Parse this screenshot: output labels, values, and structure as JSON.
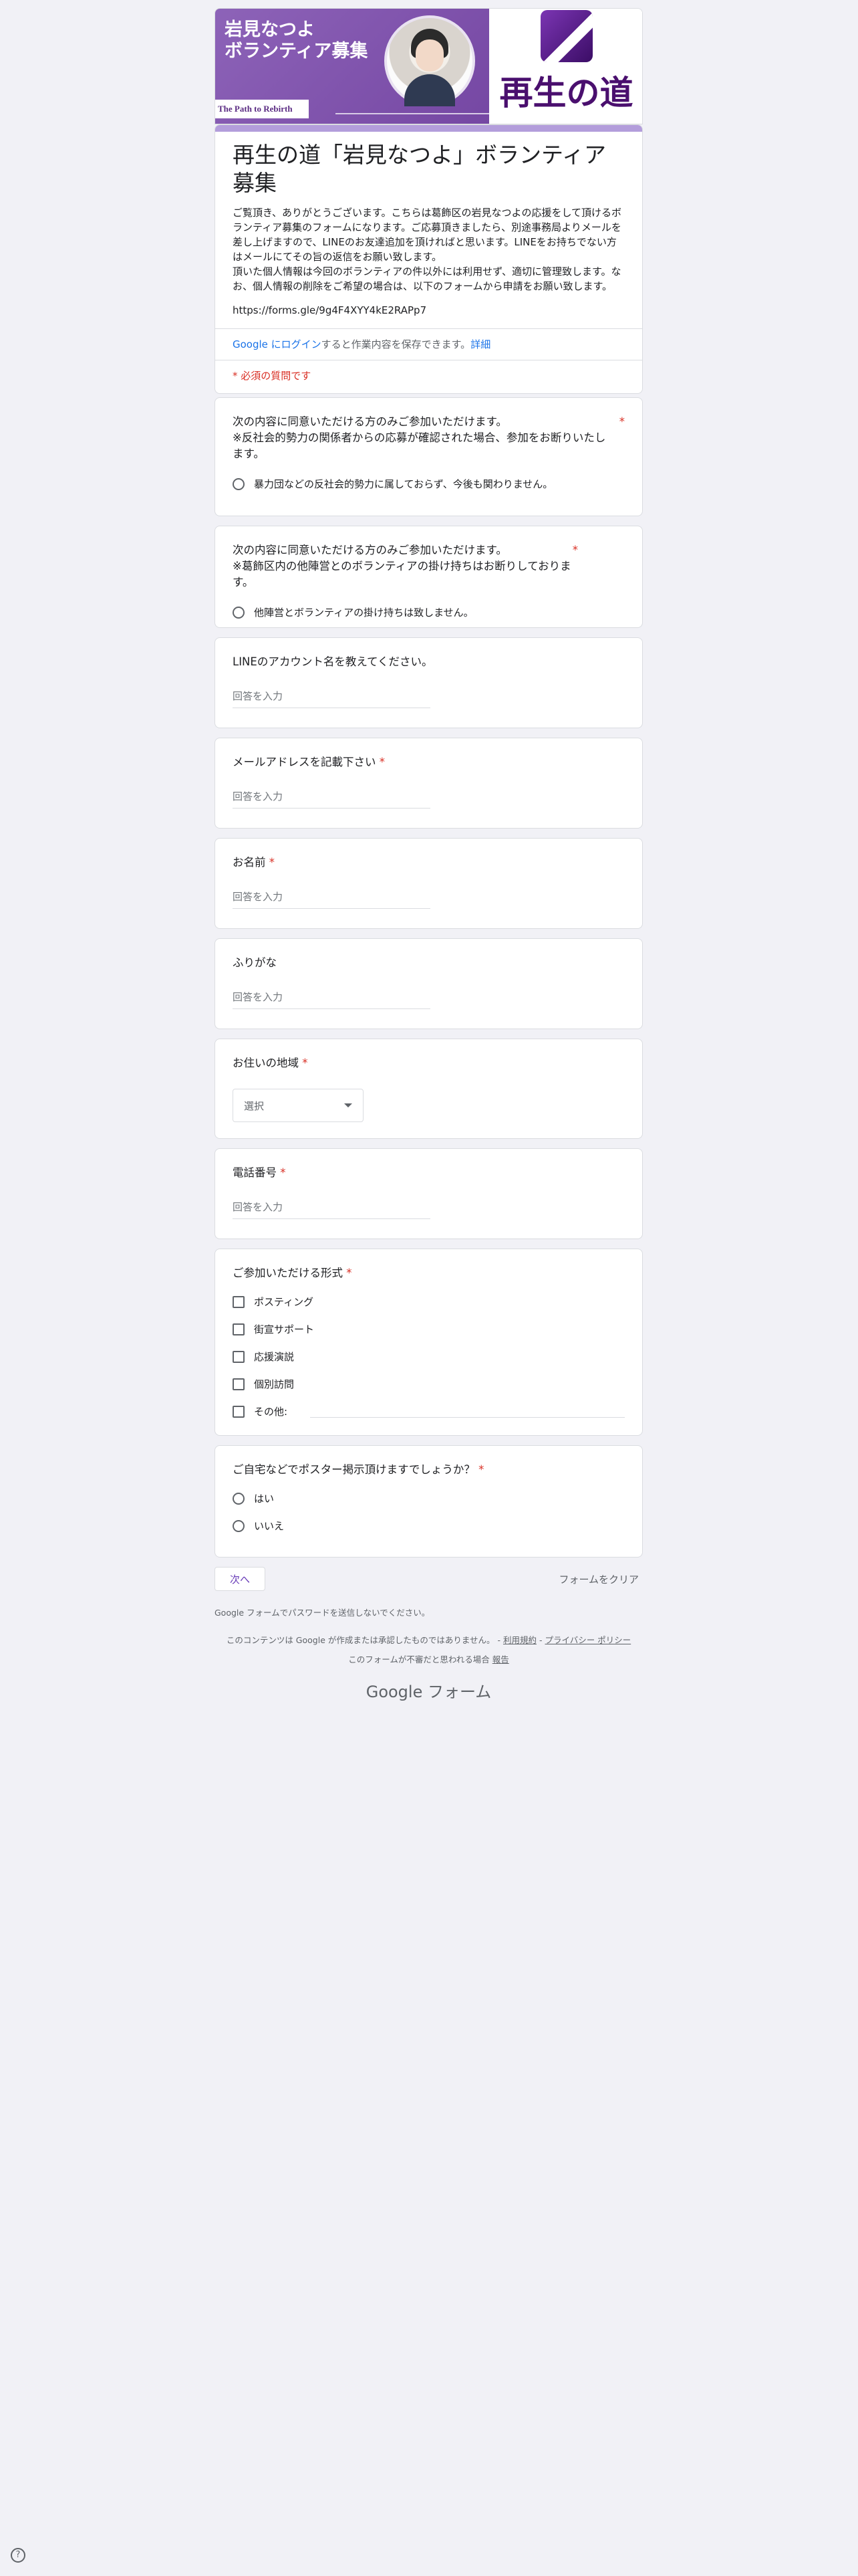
{
  "banner": {
    "title_line1": "岩見なつよ",
    "title_line2": "ボランティア募集",
    "tagline": "The Path to Rebirth",
    "logo_text": "再生の道"
  },
  "form": {
    "title": "再生の道「岩見なつよ」ボランティア募集",
    "description": "ご覧頂き、ありがとうございます。こちらは葛飾区の岩見なつよの応援をして頂けるボランティア募集のフォームになります。ご応募頂きましたら、別途事務局よりメールを差し上げますので、LINEのお友達追加を頂ければと思います。LINEをお持ちでない方はメールにてその旨の返信をお願い致します。\n頂いた個人情報は今回のボランティアの件以外には利用せず、適切に管理致します。なお、個人情報の削除をご希望の場合は、以下のフォームから申請をお願い致します。",
    "url": "https://forms.gle/9g4F4XYY4kE2RAPp7",
    "login_link": "Google にログイン",
    "login_rest": "すると作業内容を保存できます。",
    "login_more": "詳細",
    "required_note": "* 必須の質問です"
  },
  "questions": {
    "q1": {
      "title": "次の内容に同意いただける方のみご参加いただけます。\n※反社会的勢力の関係者からの応募が確認された場合、参加をお断りいたします。",
      "required": "*",
      "option": "暴力団などの反社会的勢力に属しておらず、今後も関わりません。"
    },
    "q2": {
      "title": "次の内容に同意いただける方のみご参加いただけます。\n※葛飾区内の他陣営とのボランティアの掛け持ちはお断りしております。",
      "required": "*",
      "option": "他陣営とボランティアの掛け持ちは致しません。"
    },
    "q3": {
      "title": "LINEのアカウント名を教えてください。",
      "placeholder": "回答を入力"
    },
    "q4": {
      "title": "メールアドレスを記載下さい",
      "required": "*",
      "placeholder": "回答を入力"
    },
    "q5": {
      "title": "お名前",
      "required": "*",
      "placeholder": "回答を入力"
    },
    "q6": {
      "title": "ふりがな",
      "placeholder": "回答を入力"
    },
    "q7": {
      "title": "お住いの地域",
      "required": "*",
      "select_value": "選択"
    },
    "q8": {
      "title": "電話番号",
      "required": "*",
      "placeholder": "回答を入力"
    },
    "q9": {
      "title": "ご参加いただける形式",
      "required": "*",
      "options": [
        "ポスティング",
        "街宣サポート",
        "応援演説",
        "個別訪問",
        "その他:"
      ]
    },
    "q10": {
      "title": "ご自宅などでポスター掲示頂けますでしょうか？",
      "required": "*",
      "options": [
        "はい",
        "いいえ"
      ]
    }
  },
  "footer": {
    "next_button": "次へ",
    "clear_button": "フォームをクリア",
    "password_note": "Google フォームでパスワードを送信しないでください。",
    "disclaimer": "このコンテンツは Google が作成または承認したものではありません。 -",
    "terms_link": "利用規約",
    "privacy_link": "プライバシー ポリシー",
    "report_text": "このフォームが不審だと思われる場合",
    "report_link": "報告",
    "brand": "Google フォーム",
    "help_icon": "?"
  }
}
